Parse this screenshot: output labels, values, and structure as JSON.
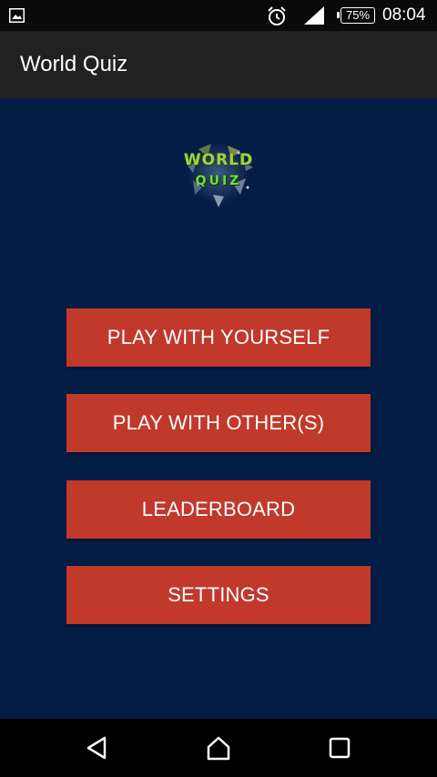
{
  "status_bar": {
    "time": "08:04",
    "battery": "75%",
    "icons": [
      "image-notification-icon",
      "alarm-icon",
      "signal-icon",
      "battery-icon"
    ]
  },
  "app_bar": {
    "title": "World Quiz"
  },
  "logo": {
    "line1": "WORLD",
    "line2": "QUIZ"
  },
  "menu": {
    "buttons": [
      {
        "label": "PLAY WITH YOURSELF"
      },
      {
        "label": "PLAY WITH OTHER(S)"
      },
      {
        "label": "LEADERBOARD"
      },
      {
        "label": "SETTINGS"
      }
    ]
  },
  "nav_bar": {
    "icons": [
      "back-icon",
      "home-icon",
      "recents-icon"
    ]
  },
  "colors": {
    "background": "#041d45",
    "button": "#c0392b",
    "app_bar": "#212121",
    "status_bar": "#0a0a0a"
  }
}
